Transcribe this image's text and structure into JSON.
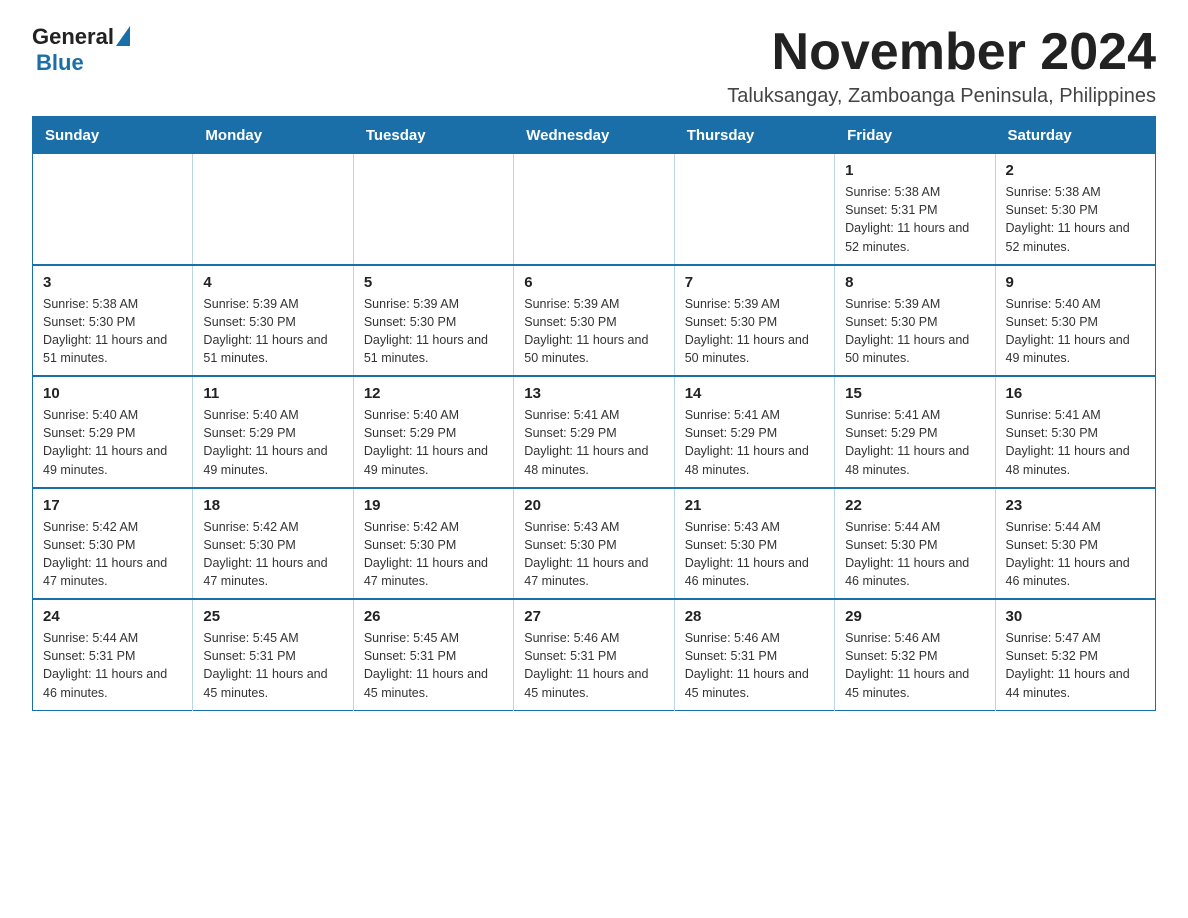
{
  "logo": {
    "text_general": "General",
    "text_blue": "Blue"
  },
  "header": {
    "month_title": "November 2024",
    "location": "Taluksangay, Zamboanga Peninsula, Philippines"
  },
  "weekdays": [
    "Sunday",
    "Monday",
    "Tuesday",
    "Wednesday",
    "Thursday",
    "Friday",
    "Saturday"
  ],
  "weeks": [
    [
      {
        "day": "",
        "info": ""
      },
      {
        "day": "",
        "info": ""
      },
      {
        "day": "",
        "info": ""
      },
      {
        "day": "",
        "info": ""
      },
      {
        "day": "",
        "info": ""
      },
      {
        "day": "1",
        "info": "Sunrise: 5:38 AM\nSunset: 5:31 PM\nDaylight: 11 hours and 52 minutes."
      },
      {
        "day": "2",
        "info": "Sunrise: 5:38 AM\nSunset: 5:30 PM\nDaylight: 11 hours and 52 minutes."
      }
    ],
    [
      {
        "day": "3",
        "info": "Sunrise: 5:38 AM\nSunset: 5:30 PM\nDaylight: 11 hours and 51 minutes."
      },
      {
        "day": "4",
        "info": "Sunrise: 5:39 AM\nSunset: 5:30 PM\nDaylight: 11 hours and 51 minutes."
      },
      {
        "day": "5",
        "info": "Sunrise: 5:39 AM\nSunset: 5:30 PM\nDaylight: 11 hours and 51 minutes."
      },
      {
        "day": "6",
        "info": "Sunrise: 5:39 AM\nSunset: 5:30 PM\nDaylight: 11 hours and 50 minutes."
      },
      {
        "day": "7",
        "info": "Sunrise: 5:39 AM\nSunset: 5:30 PM\nDaylight: 11 hours and 50 minutes."
      },
      {
        "day": "8",
        "info": "Sunrise: 5:39 AM\nSunset: 5:30 PM\nDaylight: 11 hours and 50 minutes."
      },
      {
        "day": "9",
        "info": "Sunrise: 5:40 AM\nSunset: 5:30 PM\nDaylight: 11 hours and 49 minutes."
      }
    ],
    [
      {
        "day": "10",
        "info": "Sunrise: 5:40 AM\nSunset: 5:29 PM\nDaylight: 11 hours and 49 minutes."
      },
      {
        "day": "11",
        "info": "Sunrise: 5:40 AM\nSunset: 5:29 PM\nDaylight: 11 hours and 49 minutes."
      },
      {
        "day": "12",
        "info": "Sunrise: 5:40 AM\nSunset: 5:29 PM\nDaylight: 11 hours and 49 minutes."
      },
      {
        "day": "13",
        "info": "Sunrise: 5:41 AM\nSunset: 5:29 PM\nDaylight: 11 hours and 48 minutes."
      },
      {
        "day": "14",
        "info": "Sunrise: 5:41 AM\nSunset: 5:29 PM\nDaylight: 11 hours and 48 minutes."
      },
      {
        "day": "15",
        "info": "Sunrise: 5:41 AM\nSunset: 5:29 PM\nDaylight: 11 hours and 48 minutes."
      },
      {
        "day": "16",
        "info": "Sunrise: 5:41 AM\nSunset: 5:30 PM\nDaylight: 11 hours and 48 minutes."
      }
    ],
    [
      {
        "day": "17",
        "info": "Sunrise: 5:42 AM\nSunset: 5:30 PM\nDaylight: 11 hours and 47 minutes."
      },
      {
        "day": "18",
        "info": "Sunrise: 5:42 AM\nSunset: 5:30 PM\nDaylight: 11 hours and 47 minutes."
      },
      {
        "day": "19",
        "info": "Sunrise: 5:42 AM\nSunset: 5:30 PM\nDaylight: 11 hours and 47 minutes."
      },
      {
        "day": "20",
        "info": "Sunrise: 5:43 AM\nSunset: 5:30 PM\nDaylight: 11 hours and 47 minutes."
      },
      {
        "day": "21",
        "info": "Sunrise: 5:43 AM\nSunset: 5:30 PM\nDaylight: 11 hours and 46 minutes."
      },
      {
        "day": "22",
        "info": "Sunrise: 5:44 AM\nSunset: 5:30 PM\nDaylight: 11 hours and 46 minutes."
      },
      {
        "day": "23",
        "info": "Sunrise: 5:44 AM\nSunset: 5:30 PM\nDaylight: 11 hours and 46 minutes."
      }
    ],
    [
      {
        "day": "24",
        "info": "Sunrise: 5:44 AM\nSunset: 5:31 PM\nDaylight: 11 hours and 46 minutes."
      },
      {
        "day": "25",
        "info": "Sunrise: 5:45 AM\nSunset: 5:31 PM\nDaylight: 11 hours and 45 minutes."
      },
      {
        "day": "26",
        "info": "Sunrise: 5:45 AM\nSunset: 5:31 PM\nDaylight: 11 hours and 45 minutes."
      },
      {
        "day": "27",
        "info": "Sunrise: 5:46 AM\nSunset: 5:31 PM\nDaylight: 11 hours and 45 minutes."
      },
      {
        "day": "28",
        "info": "Sunrise: 5:46 AM\nSunset: 5:31 PM\nDaylight: 11 hours and 45 minutes."
      },
      {
        "day": "29",
        "info": "Sunrise: 5:46 AM\nSunset: 5:32 PM\nDaylight: 11 hours and 45 minutes."
      },
      {
        "day": "30",
        "info": "Sunrise: 5:47 AM\nSunset: 5:32 PM\nDaylight: 11 hours and 44 minutes."
      }
    ]
  ]
}
